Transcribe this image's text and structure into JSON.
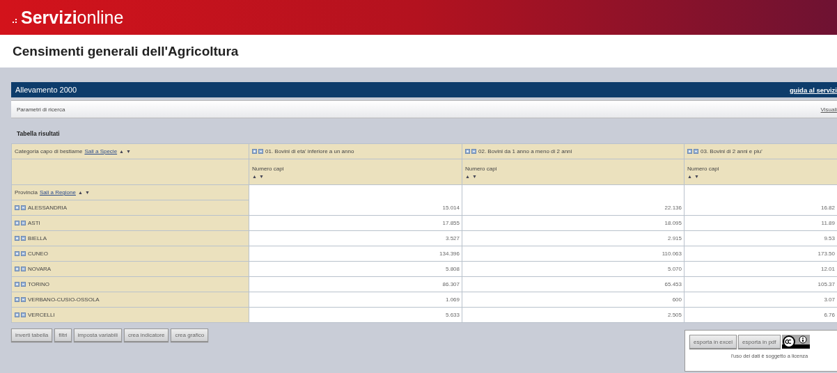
{
  "header": {
    "logo": "**Servizi**online"
  },
  "page_title": "Censimenti generali dell'Agricoltura",
  "panel": {
    "title": "Allevamento 2000",
    "help_link": "guida al servizi"
  },
  "search_params": {
    "label": "Parametri di ricerca",
    "link": "Visuali"
  },
  "results_title": "Tabella risultati",
  "table": {
    "column_dimension": {
      "label": "Categoria capo di bestiame",
      "link": "Sali a Specie",
      "sort_up": "▲",
      "sort_down": "▼"
    },
    "columns": [
      {
        "label": "01. Bovini di eta' inferiore a un anno",
        "measure": "Numero capi",
        "sort_up": "▲",
        "sort_down": "▼"
      },
      {
        "label": "02. Bovini da 1 anno a meno di 2 anni",
        "measure": "Numero capi",
        "sort_up": "▲",
        "sort_down": "▼"
      },
      {
        "label": "03. Bovini di 2 anni e piu'",
        "measure": "Numero capi",
        "sort_up": "▲",
        "sort_down": "▼"
      }
    ],
    "row_dimension": {
      "label": "Provincia",
      "link": "Sali a Regione",
      "sort_up": "▲",
      "sort_down": "▼"
    },
    "rows": [
      {
        "name": "ALESSANDRIA",
        "values": [
          "15.014",
          "22.136",
          "16.82"
        ]
      },
      {
        "name": "ASTI",
        "values": [
          "17.855",
          "18.095",
          "11.89"
        ]
      },
      {
        "name": "BIELLA",
        "values": [
          "3.527",
          "2.915",
          "9.53"
        ]
      },
      {
        "name": "CUNEO",
        "values": [
          "134.396",
          "110.063",
          "173.50"
        ]
      },
      {
        "name": "NOVARA",
        "values": [
          "5.808",
          "5.070",
          "12.01"
        ]
      },
      {
        "name": "TORINO",
        "values": [
          "86.307",
          "65.453",
          "105.37"
        ]
      },
      {
        "name": "VERBANO-CUSIO-OSSOLA",
        "values": [
          "1.069",
          "600",
          "3.07"
        ]
      },
      {
        "name": "VERCELLI",
        "values": [
          "5.633",
          "2.505",
          "6.76"
        ]
      }
    ]
  },
  "actions": [
    "inverti tabella",
    "filtri",
    "imposta variabili",
    "crea indicatore",
    "crea grafico"
  ],
  "export": {
    "buttons": [
      "esporta in excel",
      "esporta in pdf"
    ],
    "license_note": "l'uso dei dati è soggetto a licenza"
  }
}
